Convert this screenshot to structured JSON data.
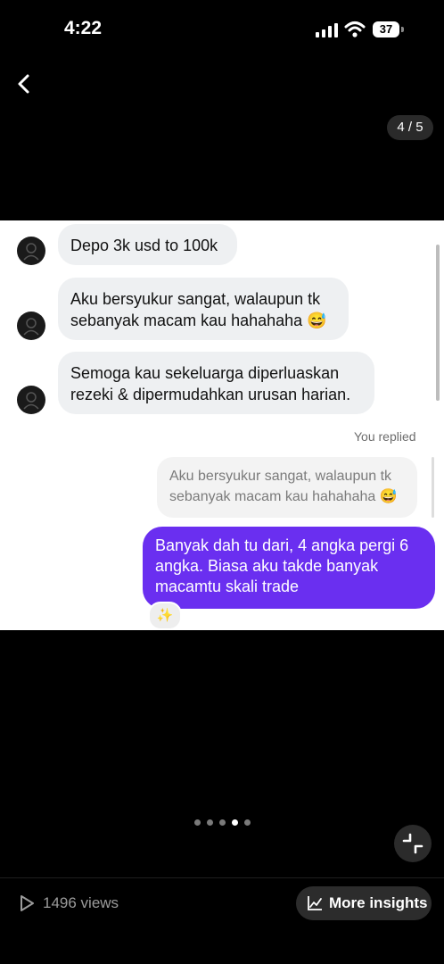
{
  "status_bar": {
    "time": "4:22",
    "battery": "37"
  },
  "viewer": {
    "page_counter": "4 / 5",
    "active_dot": 4,
    "dot_count": 5
  },
  "conversation": {
    "incoming": [
      {
        "lines": [
          "Depo 3k usd to 100k"
        ]
      },
      {
        "lines": [
          "Aku bersyukur sangat, walaupun tk",
          "sebanyak macam kau hahahaha 😅"
        ]
      },
      {
        "lines": [
          "Semoga kau sekeluarga diperluaskan",
          "rezeki & dipermudahkan urusan harian."
        ]
      }
    ],
    "replied_label": "You replied",
    "quoted": {
      "lines": [
        "Aku bersyukur sangat, walaupun tk",
        "sebanyak macam kau hahahaha 😅"
      ]
    },
    "outgoing": {
      "lines": [
        "Banyak dah tu dari, 4 angka pergi 6",
        "angka. Biasa aku takde banyak",
        "macamtu skali trade"
      ]
    },
    "reaction": "✨"
  },
  "footer": {
    "views": "1496 views",
    "insights_label": "More insights"
  },
  "icons": {
    "back": "chevron-left-icon",
    "play": "play-icon",
    "chart": "chart-icon",
    "collapse": "collapse-icon"
  },
  "colors": {
    "accent": "#6a2ff0",
    "background": "#000000"
  }
}
